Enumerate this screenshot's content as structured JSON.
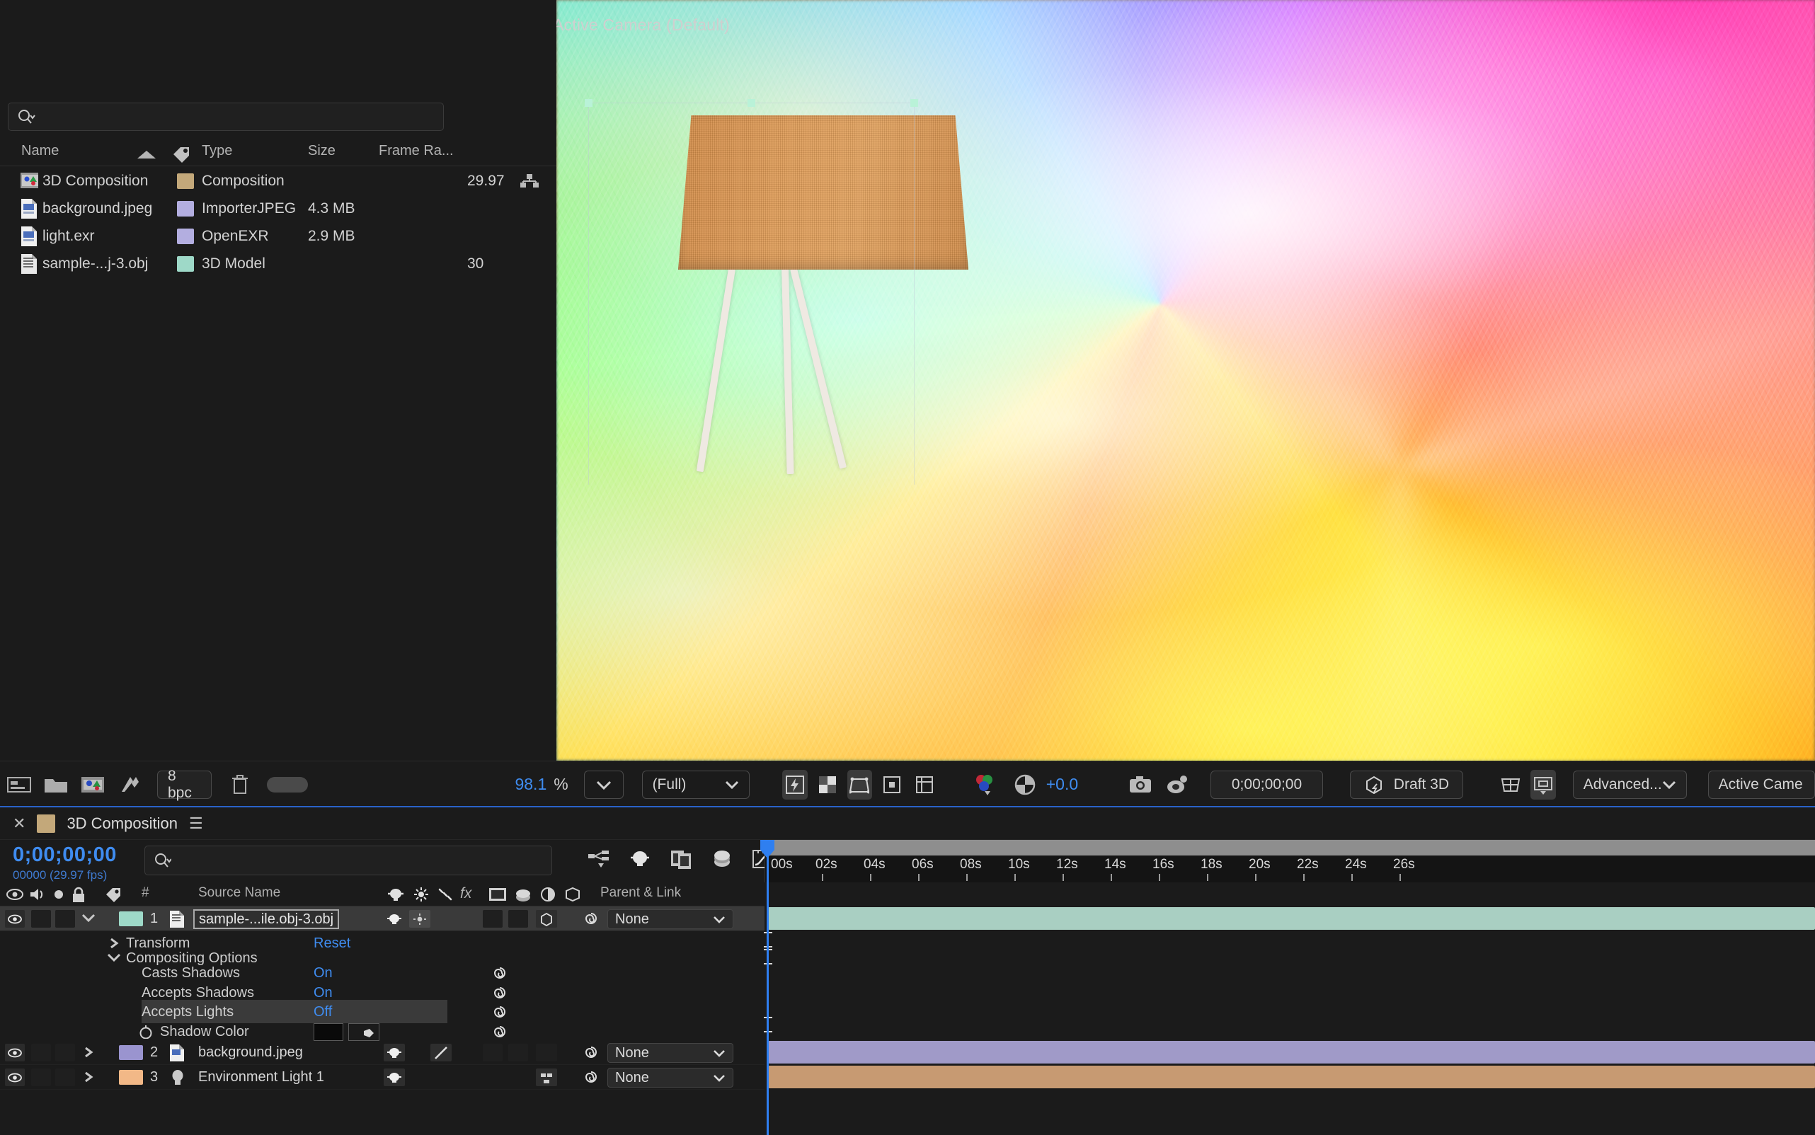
{
  "viewer": {
    "label": "Active Camera (Default)"
  },
  "project": {
    "search_placeholder": "",
    "columns": [
      "Name",
      "Type",
      "Size",
      "Frame Ra..."
    ],
    "items": [
      {
        "name": "3D Composition",
        "type": "Composition",
        "size": "",
        "frame_rate": "29.97",
        "swatch": "#c3a87a",
        "icon": "composition-icon"
      },
      {
        "name": "background.jpeg",
        "type": "ImporterJPEG",
        "size": "4.3 MB",
        "frame_rate": "",
        "swatch": "#b3aee0",
        "icon": "file-icon"
      },
      {
        "name": "light.exr",
        "type": "OpenEXR",
        "size": "2.9 MB",
        "frame_rate": "",
        "swatch": "#b3aee0",
        "icon": "file-icon"
      },
      {
        "name": "sample-...j-3.obj",
        "type": "3D Model",
        "size": "",
        "frame_rate": "30",
        "swatch": "#9ed9c8",
        "icon": "model-icon"
      }
    ]
  },
  "viewer_toolbar": {
    "bit_depth": "8 bpc",
    "zoom_value": "98.1",
    "zoom_unit": "%",
    "resolution": "(Full)",
    "exposure": "+0.0",
    "current_time": "0;00;00;00",
    "draft_3d": "Draft 3D",
    "renderer": "Advanced...",
    "camera_view": "Active Came"
  },
  "timeline": {
    "tab_title": "3D Composition",
    "timecode": "0;00;00;00",
    "frame_info": "00000 (29.97 fps)",
    "search_placeholder": "",
    "columns": {
      "num": "#",
      "source_name": "Source Name",
      "parent_link": "Parent & Link"
    },
    "ruler_ticks": [
      "00s",
      "02s",
      "04s",
      "06s",
      "08s",
      "10s",
      "12s",
      "14s",
      "16s",
      "18s",
      "20s",
      "22s",
      "24s",
      "26s"
    ],
    "layers": [
      {
        "index": "1",
        "name": "sample-...ile.obj-3.obj",
        "parent": "None",
        "swatch": "#9ed9c8",
        "selected": true,
        "bar_color": "#a9cfc2"
      },
      {
        "index": "2",
        "name": "background.jpeg",
        "parent": "None",
        "swatch": "#9a94cf",
        "selected": false,
        "bar_color": "#a09ac8"
      },
      {
        "index": "3",
        "name": "Environment Light 1",
        "parent": "None",
        "swatch": "#f2b887",
        "selected": false,
        "bar_color": "#c79a72"
      }
    ],
    "properties": {
      "transform": {
        "label": "Transform",
        "value": "Reset"
      },
      "compositing_options": {
        "label": "Compositing Options"
      },
      "rows": [
        {
          "label": "Casts Shadows",
          "value": "On",
          "highlight": false
        },
        {
          "label": "Accepts Shadows",
          "value": "On",
          "highlight": false
        },
        {
          "label": "Accepts Lights",
          "value": "Off",
          "highlight": true
        },
        {
          "label": "Shadow Color",
          "value": "",
          "highlight": false
        }
      ]
    }
  },
  "colors": {
    "accent_blue": "#3f8cf0",
    "panel_bg": "#1b1b1b",
    "selection": "#3a3a3a"
  }
}
